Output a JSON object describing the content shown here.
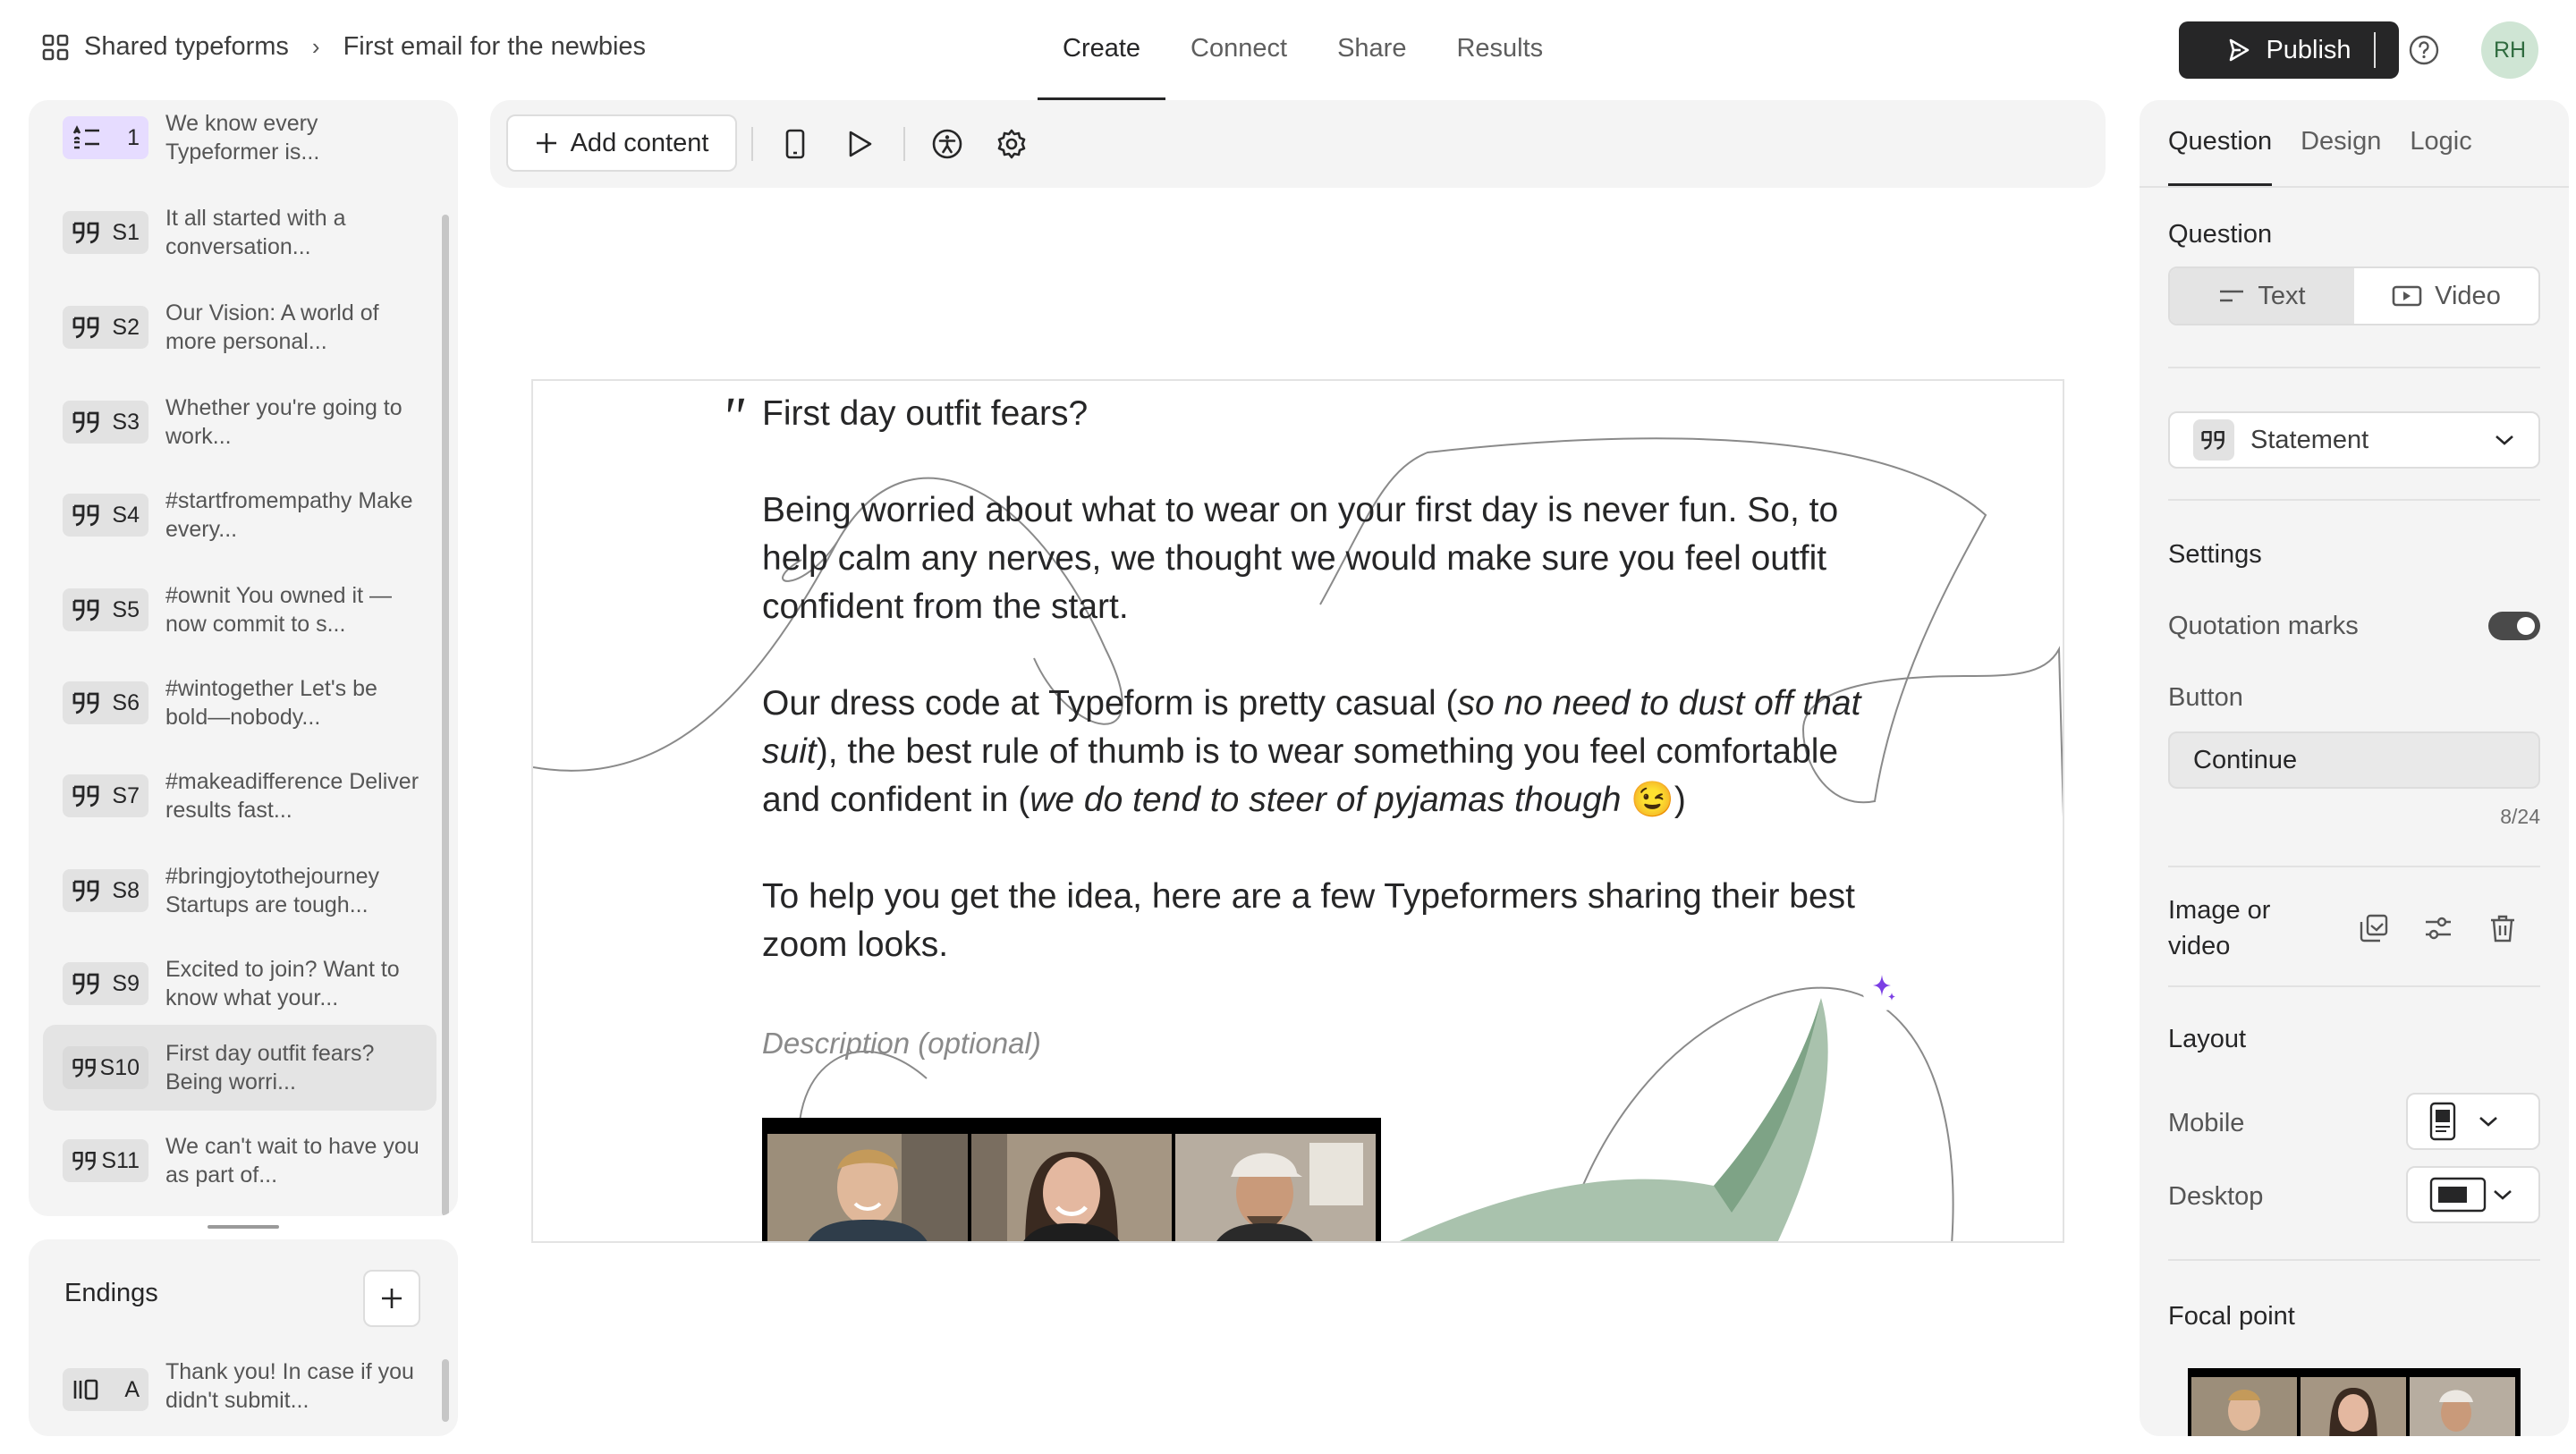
{
  "header": {
    "breadcrumb_root": "Shared typeforms",
    "breadcrumb_current": "First email for the newbies",
    "tabs": [
      {
        "label": "Create",
        "active": true
      },
      {
        "label": "Connect",
        "active": false
      },
      {
        "label": "Share",
        "active": false
      },
      {
        "label": "Results",
        "active": false
      }
    ],
    "publish_label": "Publish",
    "avatar_initials": "RH"
  },
  "sidebar": {
    "items": [
      {
        "badge": "1",
        "icon": "list-icon",
        "text": "We know every Typeformer is...",
        "selected": false
      },
      {
        "badge": "S1",
        "icon": "quote-icon",
        "text": "It all started with a conversation...",
        "selected": false
      },
      {
        "badge": "S2",
        "icon": "quote-icon",
        "text": "Our Vision: A world of more personal...",
        "selected": false
      },
      {
        "badge": "S3",
        "icon": "quote-icon",
        "text": "Whether you're going to work...",
        "selected": false
      },
      {
        "badge": "S4",
        "icon": "quote-icon",
        "text": "#startfromempathy Make every...",
        "selected": false
      },
      {
        "badge": "S5",
        "icon": "quote-icon",
        "text": "#ownit You owned it —now commit to s...",
        "selected": false
      },
      {
        "badge": "S6",
        "icon": "quote-icon",
        "text": "#wintogether Let's be bold—nobody...",
        "selected": false
      },
      {
        "badge": "S7",
        "icon": "quote-icon",
        "text": "#makeadifference Deliver results fast...",
        "selected": false
      },
      {
        "badge": "S8",
        "icon": "quote-icon",
        "text": "#bringjoytothejourney Startups are tough...",
        "selected": false
      },
      {
        "badge": "S9",
        "icon": "quote-icon",
        "text": "Excited to join? Want to know what your...",
        "selected": false
      },
      {
        "badge": "S10",
        "icon": "quote-icon",
        "text": "First day outfit fears? Being worri...",
        "selected": true
      },
      {
        "badge": "S11",
        "icon": "quote-icon",
        "text": "We can't wait to have you as part of...",
        "selected": false
      }
    ],
    "endings_title": "Endings",
    "ending_item": {
      "badge": "A",
      "icon": "ending-icon",
      "text": "Thank you! In case if you didn't submit..."
    }
  },
  "toolbar": {
    "add_content_label": "Add content"
  },
  "canvas": {
    "title": "First day outfit fears?",
    "para1": "Being worried about what to wear on your first day is never fun. So, to help calm any nerves, we thought we would make sure you feel outfit confident from the start.",
    "para2_a": "Our dress code at Typeform is pretty casual (",
    "para2_b": "so no need to dust off that suit",
    "para2_c": "), the best rule of thumb is to wear something you feel comfortable and confident in (",
    "para2_d": "we do tend to steer of pyjamas though",
    "para2_e": " 😉)",
    "para3": "To help you get the idea, here are a few Typeformers sharing their best zoom looks.",
    "description_placeholder": "Description (optional)"
  },
  "right_panel": {
    "tabs": [
      {
        "label": "Question",
        "active": true
      },
      {
        "label": "Design",
        "active": false
      },
      {
        "label": "Logic",
        "active": false
      }
    ],
    "question_heading": "Question",
    "segment_text": "Text",
    "segment_video": "Video",
    "type_label": "Statement",
    "settings_heading": "Settings",
    "quotation_marks_label": "Quotation marks",
    "quotation_marks_on": true,
    "button_label": "Button",
    "button_value": "Continue",
    "button_counter": "8/24",
    "image_or_video_label": "Image or video",
    "layout_heading": "Layout",
    "mobile_label": "Mobile",
    "desktop_label": "Desktop",
    "focal_point_heading": "Focal point"
  },
  "colors": {
    "publish_bg": "#262627",
    "avatar_bg": "#cfe5d4",
    "panel_bg": "#f4f4f4",
    "first_badge_bg": "#e6dcff",
    "sparkle": "#7b3fe4"
  }
}
